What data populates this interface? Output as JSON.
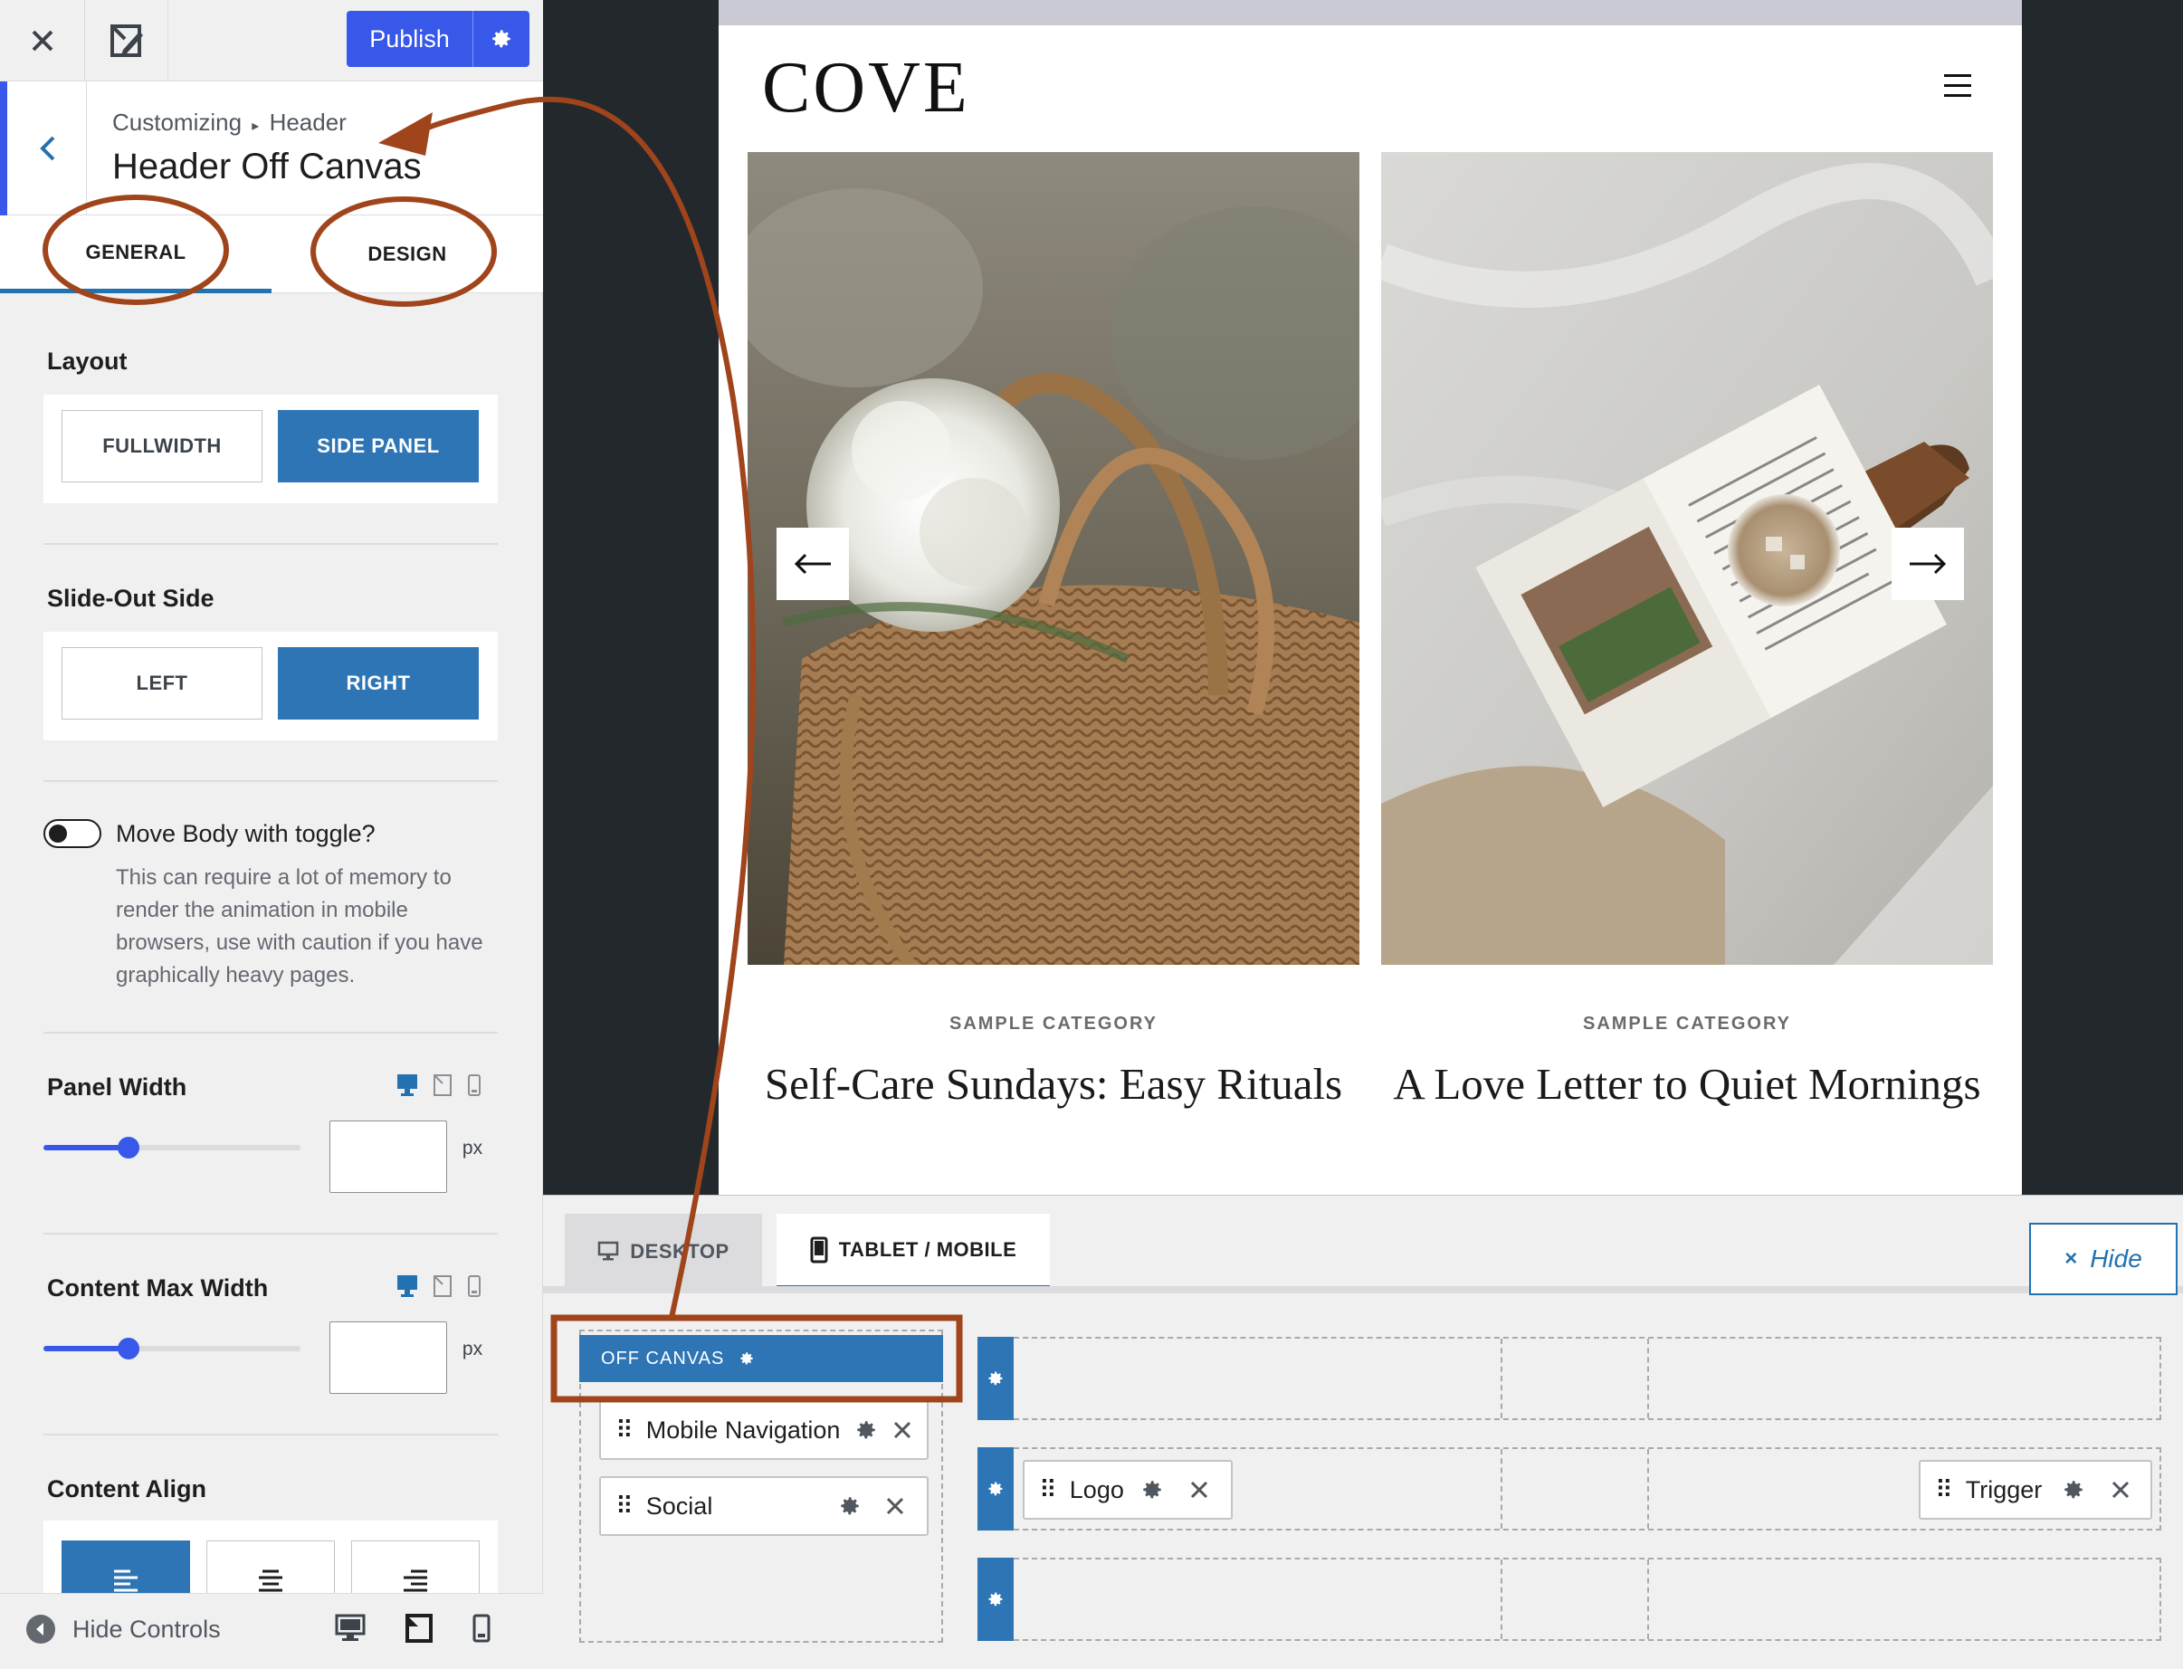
{
  "sidebar": {
    "close_icon": "close-icon",
    "edit_icon": "edit-icon",
    "publish_label": "Publish",
    "breadcrumb_root": "Customizing",
    "breadcrumb_sep": "▸",
    "breadcrumb_parent": "Header",
    "section_title": "Header Off Canvas",
    "tabs": [
      {
        "label": "GENERAL"
      },
      {
        "label": "DESIGN"
      }
    ],
    "layout": {
      "label": "Layout",
      "options": [
        "FULLWIDTH",
        "SIDE PANEL"
      ],
      "selected": "SIDE PANEL"
    },
    "slide_out": {
      "label": "Slide-Out Side",
      "options": [
        "LEFT",
        "RIGHT"
      ],
      "selected": "RIGHT"
    },
    "move_body": {
      "label": "Move Body with toggle?",
      "checked": false,
      "help": "This can require a lot of memory to render the animation in mobile browsers, use with caution if you have graphically heavy pages."
    },
    "panel_width": {
      "label": "Panel Width",
      "value": "",
      "unit": "px",
      "slider_fraction": 0.33
    },
    "content_max_width": {
      "label": "Content Max Width",
      "value": "",
      "unit": "px",
      "slider_fraction": 0.33
    },
    "content_align": {
      "label": "Content Align",
      "options": [
        "left",
        "center",
        "right"
      ],
      "selected": "left"
    },
    "footer": {
      "hide_controls": "Hide Controls"
    }
  },
  "preview": {
    "site_title": "COVE",
    "posts": [
      {
        "category": "SAMPLE CATEGORY",
        "title": "Self-Care Sundays: Easy Rituals"
      },
      {
        "category": "SAMPLE CATEGORY",
        "title": "A Love Letter to Quiet Mornings"
      }
    ],
    "slider_prev": "←",
    "slider_next": "→"
  },
  "builder": {
    "tabs": [
      {
        "label": "DESKTOP"
      },
      {
        "label": "TABLET / MOBILE"
      }
    ],
    "active_tab": "TABLET / MOBILE",
    "hide_label": "Hide",
    "hide_x": "×",
    "off_canvas": {
      "label": "OFF CANVAS",
      "items": [
        "Mobile Navigation",
        "Social"
      ]
    },
    "rows": {
      "top": [],
      "main": {
        "left": [
          "Logo"
        ],
        "right": [
          "Trigger"
        ]
      },
      "bottom": []
    }
  },
  "colors": {
    "accent": "#3858e9",
    "selected_button": "#2e75b6",
    "annotation": "#a0441c",
    "preview_bg": "#23282d"
  }
}
